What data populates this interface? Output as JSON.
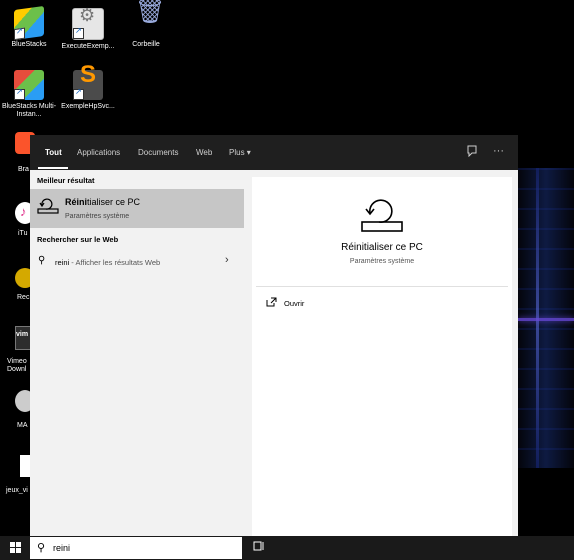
{
  "desktop_icons": [
    {
      "label": "BlueStacks"
    },
    {
      "label": "ExecuteExemp..."
    },
    {
      "label": "Corbeille"
    },
    {
      "label": "BlueStacks Multi-Instan..."
    },
    {
      "label": "ExempleHpSvc..."
    }
  ],
  "partial_icons": [
    "Bra",
    "iTu",
    "Rec",
    "Vimeo Downl",
    "MA",
    "jeux_vi"
  ],
  "tabs": [
    {
      "label": "Tout",
      "active": true
    },
    {
      "label": "Applications"
    },
    {
      "label": "Documents"
    },
    {
      "label": "Web"
    },
    {
      "label": "Plus ▾"
    }
  ],
  "top_icons": {
    "feedback": "feedback-icon",
    "more": "···"
  },
  "left": {
    "best_header": "Meilleur résultat",
    "best": {
      "title_bold": "Réini",
      "title_rest": "tialiser ce PC",
      "subtitle": "Paramètres système"
    },
    "web_header": "Rechercher sur le Web",
    "web": {
      "query": "reini",
      "rest": " - Afficher les résultats Web"
    }
  },
  "right": {
    "title": "Réinitialiser ce PC",
    "subtitle": "Paramètres système",
    "open_label": "Ouvrir"
  },
  "taskbar": {
    "search_value": "reini"
  },
  "colors": {
    "panel_bg": "#f2f2f2",
    "topbar": "#1f1f1f",
    "selected": "#c6c6c6"
  }
}
